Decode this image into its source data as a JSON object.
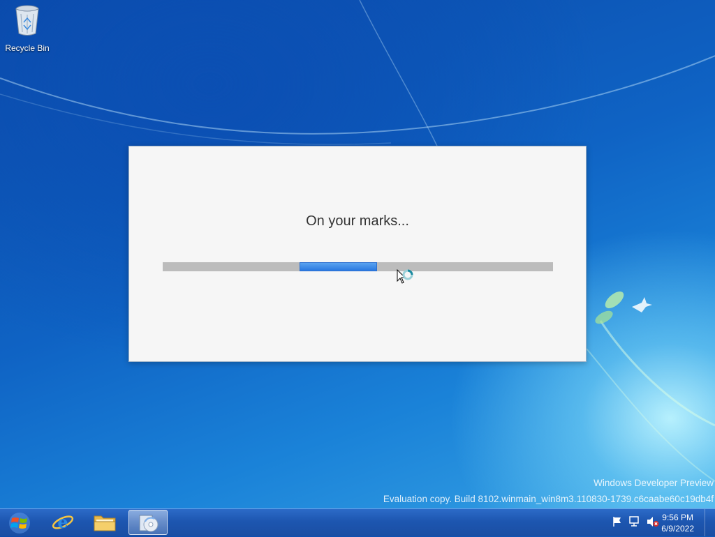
{
  "desktop": {
    "icons": [
      {
        "label": "Recycle Bin",
        "icon": "recycle-bin-icon"
      }
    ],
    "watermark": {
      "line1": "Windows Developer Preview",
      "line2": "Evaluation copy. Build 8102.winmain_win8m3.110830-1739.c6caabe60c19db4f"
    }
  },
  "dialog": {
    "message": "On your marks...",
    "progress": {
      "start_fraction": 0.35,
      "end_fraction": 0.55
    }
  },
  "taskbar": {
    "start_icon": "windows-logo-icon",
    "pinned": [
      {
        "icon": "internet-explorer-icon",
        "active": false
      },
      {
        "icon": "file-explorer-icon",
        "active": false
      },
      {
        "icon": "setup-disc-icon",
        "active": true
      }
    ],
    "tray_icons": [
      "action-center-flag-icon",
      "network-icon",
      "volume-muted-icon"
    ],
    "clock": {
      "time": "9:56 PM",
      "date": "6/9/2022"
    }
  },
  "colors": {
    "progress_fill": "#2a78e0",
    "progress_track": "#bcbcbc",
    "taskbar": "#1d56b0"
  }
}
